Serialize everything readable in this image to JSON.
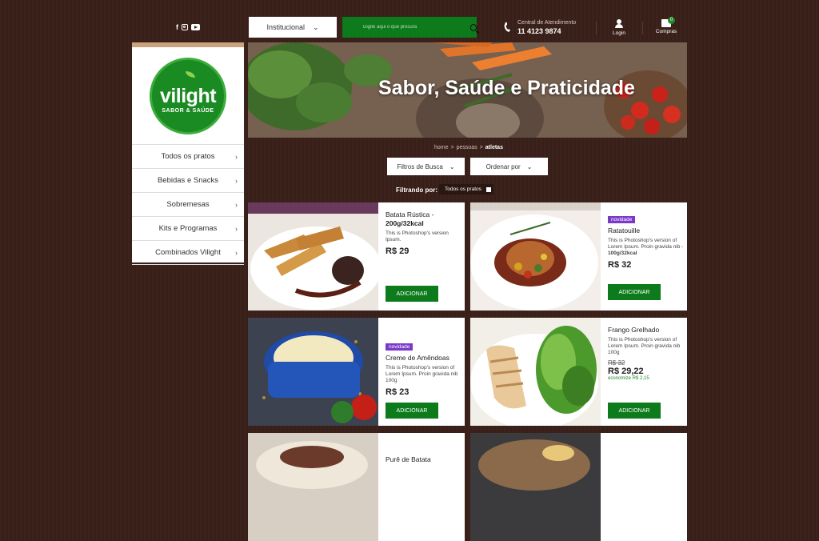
{
  "header": {
    "social_icons": [
      "facebook-icon",
      "instagram-icon",
      "youtube-icon"
    ],
    "institutional_label": "Institucional",
    "search_placeholder": "Digite aqui o que procura",
    "customer_service_label": "Central de Atendimento",
    "customer_service_phone": "11  4123 9874",
    "login_label": "Login",
    "cart_label": "Compras",
    "cart_count": "0"
  },
  "brand": {
    "name": "vilight",
    "tagline": "SABOR & SAÚDE"
  },
  "sidebar": {
    "items": [
      {
        "label": "Todos os pratos"
      },
      {
        "label": "Bebidas e Snacks"
      },
      {
        "label": "Sobremesas"
      },
      {
        "label": "Kits e Programas"
      },
      {
        "label": "Combinados Vilight"
      }
    ]
  },
  "banner": {
    "title": "Sabor, Saúde e Praticidade"
  },
  "breadcrumb": {
    "home": "home",
    "sep": ">",
    "section": "pessoas",
    "current": "atletas"
  },
  "filters": {
    "search_filter": "Filtros de Busca",
    "sort": "Ordenar por",
    "filtering_label": "Filtrando por:",
    "active_tag": "Todos os pratos"
  },
  "products": [
    {
      "name": "Batata Rústica -",
      "name_bold": "200g/32kcal",
      "desc": "This is Photoshop's version Ipsum.",
      "price": "R$ 29",
      "button": "ADICIONAR"
    },
    {
      "badge": "novidade",
      "name": "Ratatouille",
      "desc": "This is Photoshop's version of Lorem Ipsum. Proin gravida nib - ",
      "desc_bold": "100g/32kcal",
      "price": "R$ 32",
      "button": "ADICIONAR"
    },
    {
      "badge": "novidade",
      "name": "Creme de Amêndoas",
      "desc": "This is Photoshop's version of Lorem Ipsum. Proin gravida nib 100g",
      "price": "R$ 23",
      "button": "ADICIONAR"
    },
    {
      "name": "Frango Grelhado",
      "desc": "This is Photoshop's version of Lorem Ipsum. Proin gravida nib 100g",
      "old_price": "R$ 32",
      "price": "R$ 29,22",
      "saving": "economize R$ 2,15",
      "button": "ADICIONAR"
    },
    {
      "name": "Purê de Batata"
    }
  ],
  "colors": {
    "background": "#3a2019",
    "brand_green": "#0d7a1c",
    "novidade_purple": "#7b39c9"
  }
}
